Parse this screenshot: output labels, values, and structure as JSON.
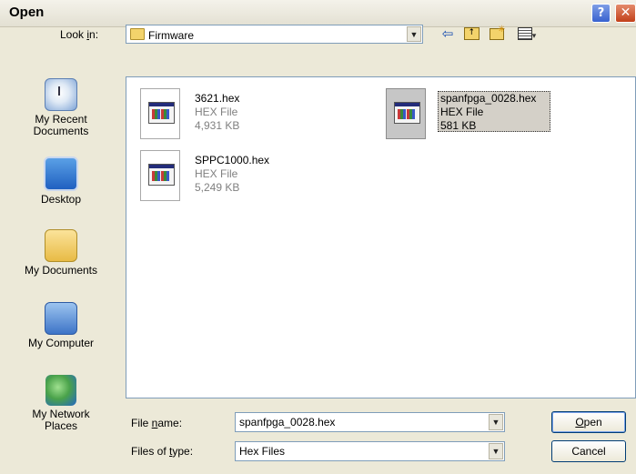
{
  "window": {
    "title": "Open",
    "help_glyph": "?",
    "close_glyph": "✕"
  },
  "lookin": {
    "label_prefix": "Look ",
    "label_accel": "i",
    "label_suffix": "n:",
    "value": "Firmware"
  },
  "toolbar": {
    "back_icon": "back-arrow-icon",
    "up_icon": "up-folder-icon",
    "new_folder_icon": "new-folder-icon",
    "views_icon": "views-menu-icon"
  },
  "places": [
    {
      "label": "My Recent Documents",
      "icon": "recent-documents-icon"
    },
    {
      "label": "Desktop",
      "icon": "desktop-icon"
    },
    {
      "label": "My Documents",
      "icon": "my-documents-icon"
    },
    {
      "label": "My Computer",
      "icon": "my-computer-icon"
    },
    {
      "label": "My Network Places",
      "icon": "network-places-icon"
    }
  ],
  "files": [
    {
      "name": "3621.hex",
      "type": "HEX File",
      "size": "4,931 KB",
      "selected": false
    },
    {
      "name": "spanfpga_0028.hex",
      "type": "HEX File",
      "size": "581 KB",
      "selected": true
    },
    {
      "name": "SPPC1000.hex",
      "type": "HEX File",
      "size": "5,249 KB",
      "selected": false
    }
  ],
  "filename": {
    "label_prefix": "File ",
    "label_accel": "n",
    "label_suffix": "ame:",
    "value": "spanfpga_0028.hex"
  },
  "filetype": {
    "label_prefix": "Files of ",
    "label_accel": "t",
    "label_suffix": "ype:",
    "value": "Hex Files"
  },
  "buttons": {
    "open_accel": "O",
    "open_rest": "pen",
    "cancel": "Cancel"
  }
}
